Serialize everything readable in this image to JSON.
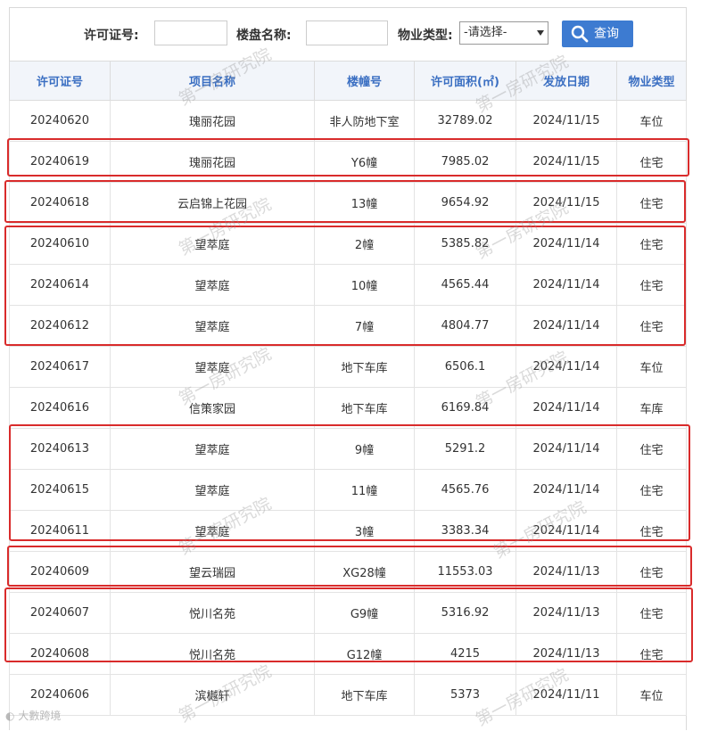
{
  "search": {
    "permit_label": "许可证号:",
    "project_label": "楼盘名称:",
    "type_label": "物业类型:",
    "type_selected": "-请选择-",
    "button_label": "查询",
    "permit_value": "",
    "project_value": ""
  },
  "table": {
    "headers": [
      "许可证号",
      "项目名称",
      "楼幢号",
      "许可面积(㎡)",
      "发放日期",
      "物业类型"
    ],
    "rows": [
      [
        "20240620",
        "瑰丽花园",
        "非人防地下室",
        "32789.02",
        "2024/11/15",
        "车位"
      ],
      [
        "20240619",
        "瑰丽花园",
        "Y6幢",
        "7985.02",
        "2024/11/15",
        "住宅"
      ],
      [
        "20240618",
        "云启锦上花园",
        "13幢",
        "9654.92",
        "2024/11/15",
        "住宅"
      ],
      [
        "20240610",
        "望萃庭",
        "2幢",
        "5385.82",
        "2024/11/14",
        "住宅"
      ],
      [
        "20240614",
        "望萃庭",
        "10幢",
        "4565.44",
        "2024/11/14",
        "住宅"
      ],
      [
        "20240612",
        "望萃庭",
        "7幢",
        "4804.77",
        "2024/11/14",
        "住宅"
      ],
      [
        "20240617",
        "望萃庭",
        "地下车库",
        "6506.1",
        "2024/11/14",
        "车位"
      ],
      [
        "20240616",
        "信策家园",
        "地下车库",
        "6169.84",
        "2024/11/14",
        "车库"
      ],
      [
        "20240613",
        "望萃庭",
        "9幢",
        "5291.2",
        "2024/11/14",
        "住宅"
      ],
      [
        "20240615",
        "望萃庭",
        "11幢",
        "4565.76",
        "2024/11/14",
        "住宅"
      ],
      [
        "20240611",
        "望萃庭",
        "3幢",
        "3383.34",
        "2024/11/14",
        "住宅"
      ],
      [
        "20240609",
        "望云瑞园",
        "XG28幢",
        "11553.03",
        "2024/11/13",
        "住宅"
      ],
      [
        "20240607",
        "悦川名苑",
        "G9幢",
        "5316.92",
        "2024/11/13",
        "住宅"
      ],
      [
        "20240608",
        "悦川名苑",
        "G12幢",
        "4215",
        "2024/11/13",
        "住宅"
      ],
      [
        "20240606",
        "滨樾轩",
        "地下车库",
        "5373",
        "2024/11/11",
        "车位"
      ]
    ]
  },
  "watermark": "第一房研究院",
  "corner_mark": "大數跨境",
  "colors": {
    "header_text": "#3b6fc2",
    "button_bg": "#3d7bd1",
    "highlight": "#d92b2b"
  }
}
